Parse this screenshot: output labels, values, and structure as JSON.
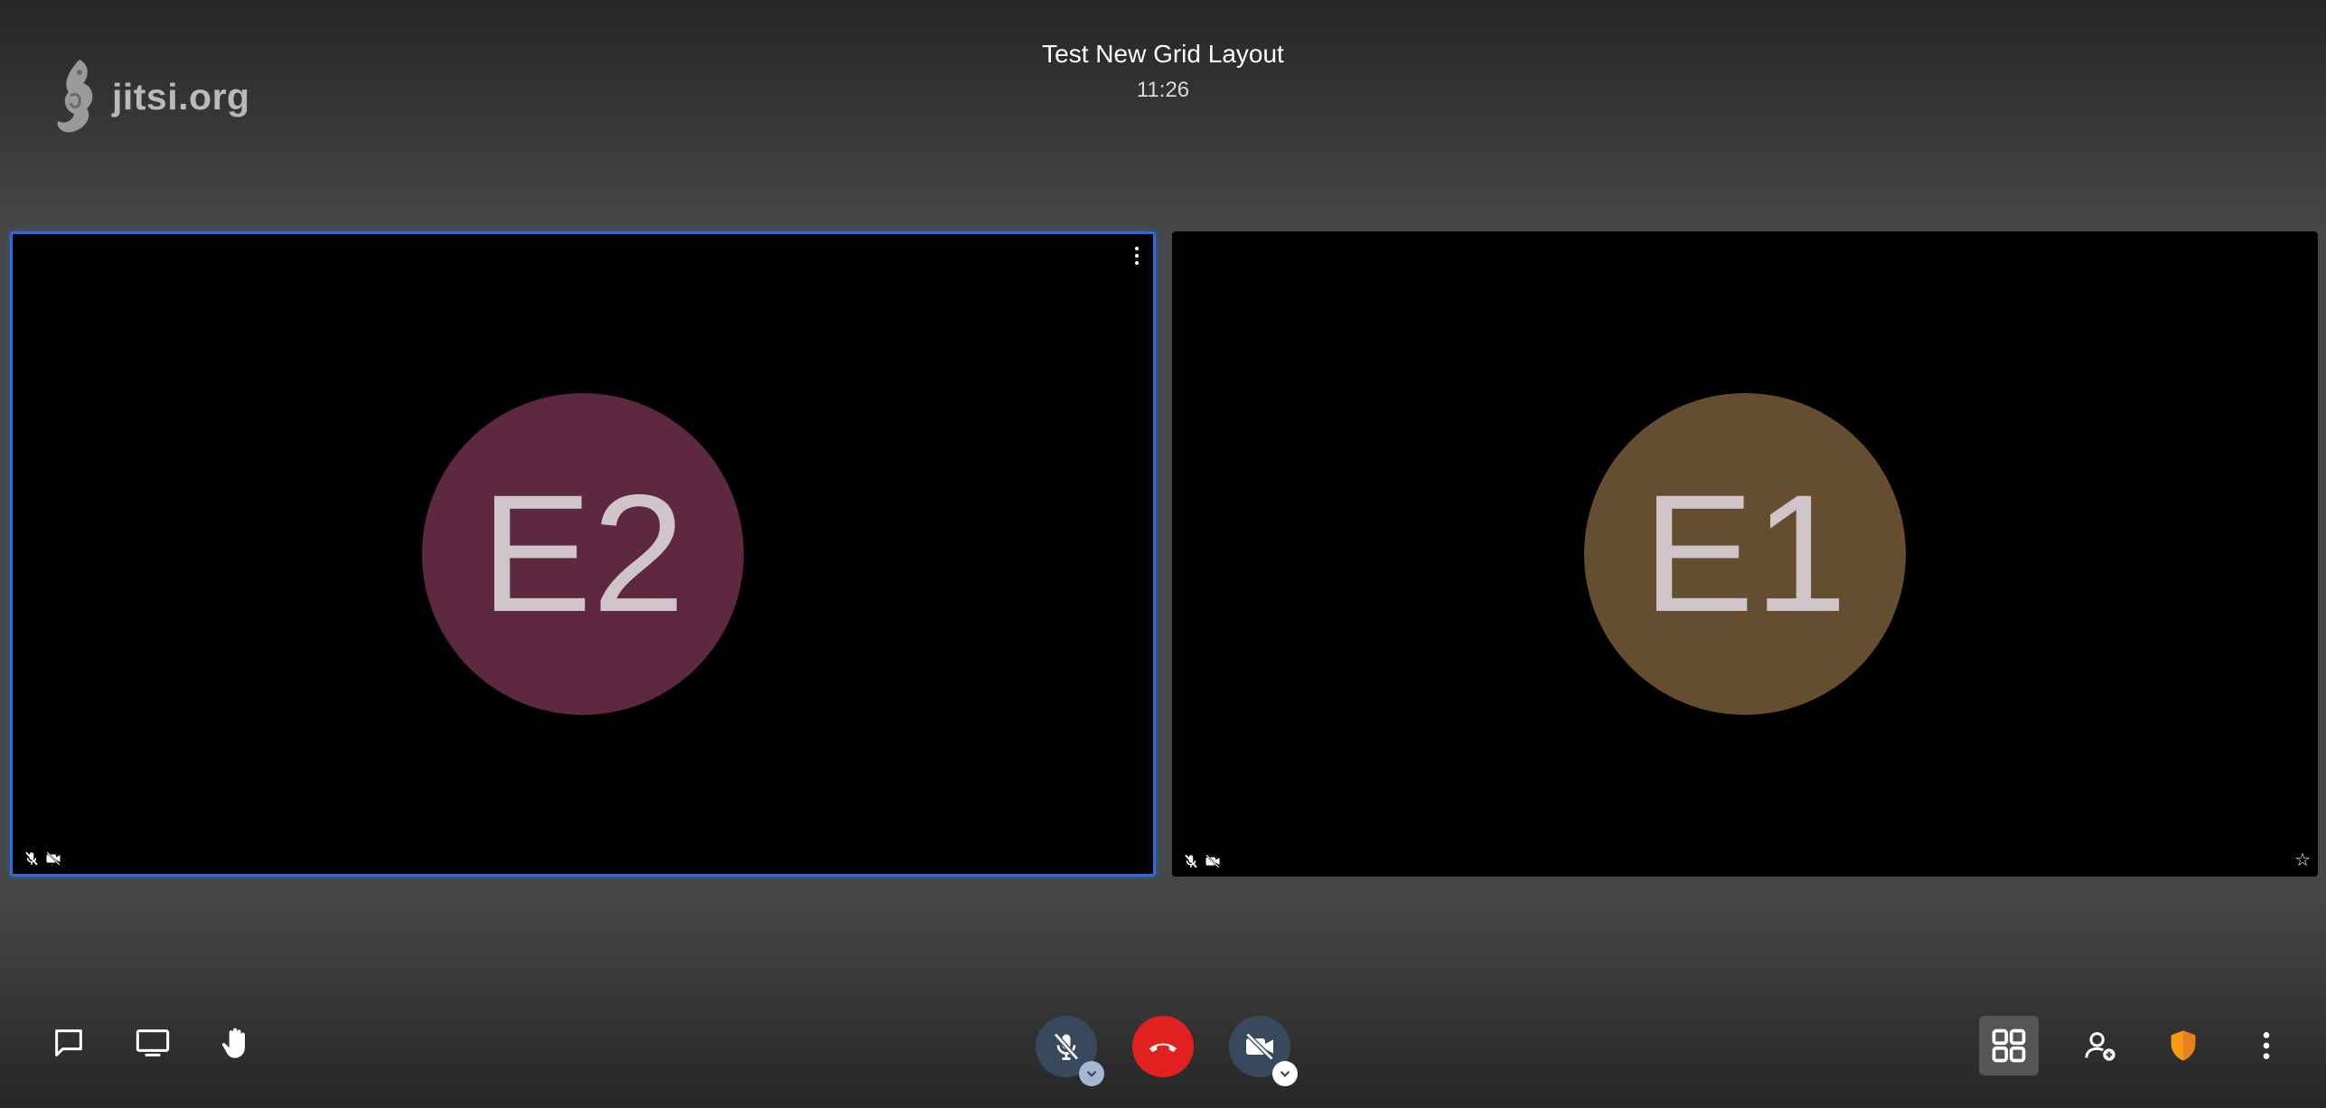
{
  "logo": {
    "text": "jitsi.org"
  },
  "header": {
    "title": "Test New Grid Layout",
    "time": "11:26"
  },
  "tiles": [
    {
      "initials": "E2",
      "avatar_color": "#5f2841",
      "selected": true
    },
    {
      "initials": "E1",
      "avatar_color": "#654e2f",
      "selected": false
    }
  ],
  "colors": {
    "active_border": "#246fe5",
    "hangup": "#e0211f",
    "toggle_bg": "#38495e",
    "security": "#f39c12"
  },
  "toolbar": {
    "left": [
      "chat-icon",
      "share-screen-icon",
      "raise-hand-icon"
    ],
    "center": [
      "microphone-muted-icon",
      "hangup-icon",
      "camera-muted-icon"
    ],
    "right": [
      "tile-view-icon",
      "invite-icon",
      "security-shield-icon",
      "more-options-icon"
    ]
  }
}
